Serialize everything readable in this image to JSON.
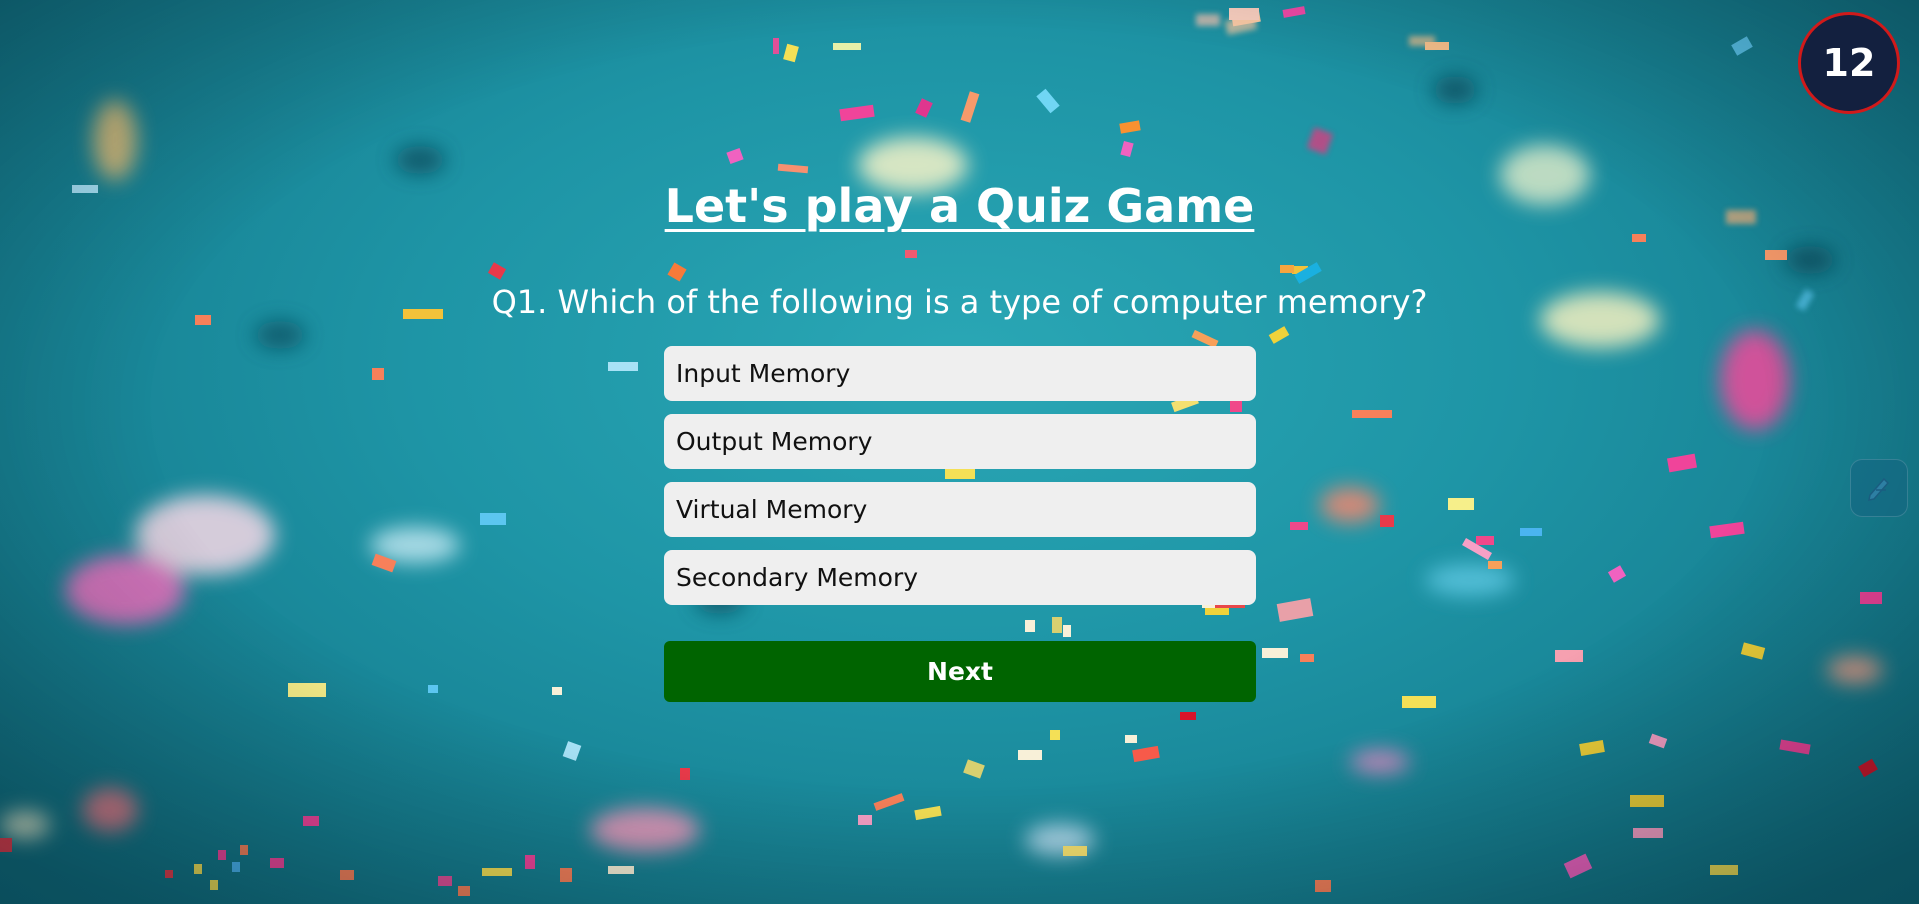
{
  "timer": {
    "value": "12"
  },
  "quiz": {
    "title": "Let's play a Quiz Game",
    "question": "Q1. Which of the following is a type of computer memory?",
    "options": [
      {
        "label": "Input Memory"
      },
      {
        "label": "Output Memory"
      },
      {
        "label": "Virtual Memory"
      },
      {
        "label": "Secondary Memory"
      }
    ],
    "next_label": "Next"
  },
  "icons": {
    "background": "confetti-background",
    "side_widget": "pen-icon"
  },
  "colors": {
    "background": "#1e95a6",
    "timer_bg": "#13203f",
    "timer_border": "#d11a1a",
    "option_bg": "#efefef",
    "next_bg": "#006400"
  }
}
